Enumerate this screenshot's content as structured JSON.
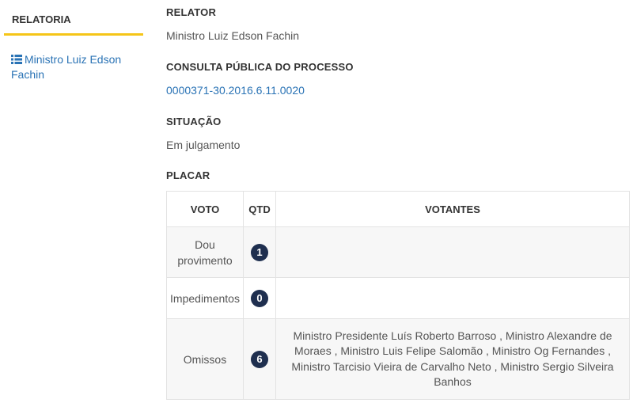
{
  "sidebar": {
    "title": "RELATORIA",
    "link_label": "Ministro Luiz Edson Fachin",
    "accent_color": "#f5c518"
  },
  "relator": {
    "label": "RELATOR",
    "value": "Ministro Luiz Edson Fachin"
  },
  "consulta": {
    "label": "CONSULTA PÚBLICA DO PROCESSO",
    "value": "0000371-30.2016.6.11.0020"
  },
  "situacao": {
    "label": "SITUAÇÃO",
    "value": "Em julgamento"
  },
  "placar": {
    "label": "PLACAR",
    "headers": {
      "voto": "VOTO",
      "qtd": "QTD",
      "votantes": "VOTANTES"
    },
    "rows": [
      {
        "voto": "Dou provimento",
        "qtd": "1",
        "votantes": ""
      },
      {
        "voto": "Impedimentos",
        "qtd": "0",
        "votantes": ""
      },
      {
        "voto": "Omissos",
        "qtd": "6",
        "votantes": "Ministro Presidente Luís Roberto Barroso , Ministro Alexandre de Moraes , Ministro Luis Felipe Salomão , Ministro Og Fernandes , Ministro Tarcisio Vieira de Carvalho Neto , Ministro Sergio Silveira Banhos"
      }
    ]
  },
  "colors": {
    "link": "#2a73b5",
    "badge": "#1f2f4f"
  },
  "icons": {
    "sidebar_link_icon": "list-icon"
  }
}
